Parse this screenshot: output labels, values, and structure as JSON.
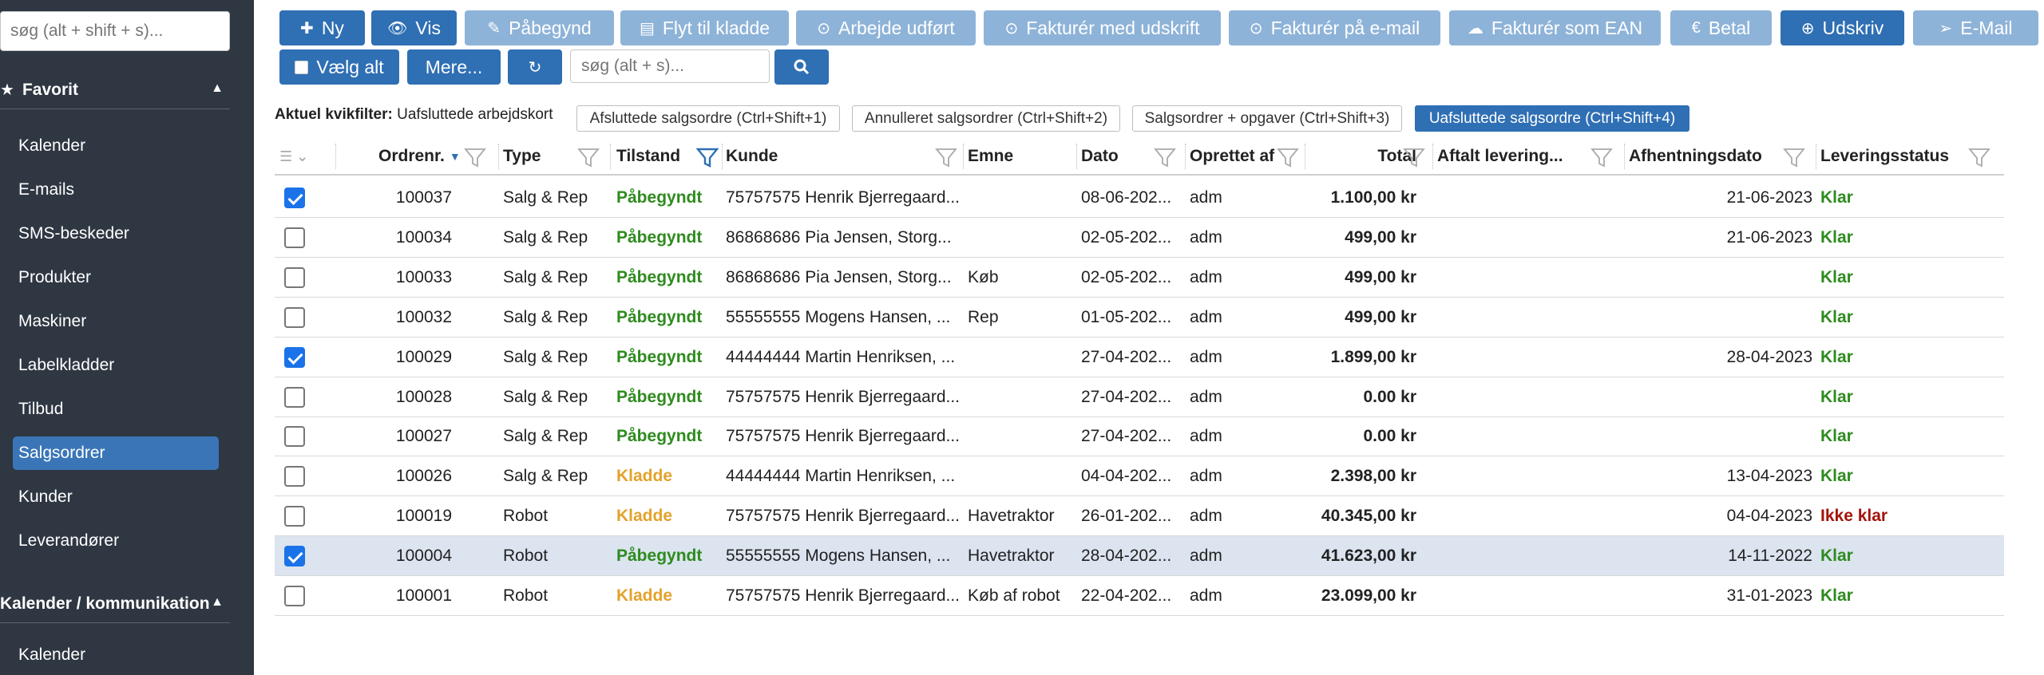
{
  "sidebar": {
    "search_placeholder": "søg (alt + shift + s)...",
    "favorites_title": "Favorit",
    "items": [
      "Kalender",
      "E-mails",
      "SMS-beskeder",
      "Produkter",
      "Maskiner",
      "Labelkladder",
      "Tilbud",
      "Salgsordrer",
      "Kunder",
      "Leverandører"
    ],
    "active_item": "Salgsordrer",
    "comm_title": "Kalender / kommunikation",
    "comm_items": [
      "Kalender"
    ]
  },
  "toolbar": {
    "ny": "Ny",
    "vis": "Vis",
    "paabegynd": "Påbegynd",
    "flyt": "Flyt til kladde",
    "arbejde": "Arbejde udført",
    "fak_udskrift": "Fakturér med udskrift",
    "fak_email": "Fakturér på e-mail",
    "fak_ean": "Fakturér som EAN",
    "betal": "Betal",
    "udskriv": "Udskriv",
    "email": "E-Mail",
    "vaelg_alt": "Vælg alt",
    "mere": "Mere...",
    "search_placeholder": "søg (alt + s)..."
  },
  "quickfilter": {
    "label": "Aktuel kvikfilter:",
    "current": "Uafsluttede arbejdskort",
    "buttons": [
      "Afsluttede salgsordre (Ctrl+Shift+1)",
      "Annulleret salgsordrer (Ctrl+Shift+2)",
      "Salgsordrer + opgaver (Ctrl+Shift+3)",
      "Uafsluttede salgsordre (Ctrl+Shift+4)"
    ],
    "active_index": 3
  },
  "table": {
    "columns": {
      "ordrenr": "Ordrenr.",
      "type": "Type",
      "tilstand": "Tilstand",
      "kunde": "Kunde",
      "emne": "Emne",
      "dato": "Dato",
      "oprettet": "Oprettet af",
      "total": "Total",
      "aftalt": "Aftalt levering...",
      "afhentning": "Afhentningsdato",
      "leveringsstatus": "Leveringsstatus"
    },
    "rows": [
      {
        "checked": true,
        "selected": false,
        "ordrenr": "100037",
        "type": "Salg & Rep",
        "tilstand": "Påbegyndt",
        "tilstand_kind": "green",
        "kunde": "75757575 Henrik Bjerregaard...",
        "emne": "",
        "dato": "08-06-202...",
        "oprettet": "adm",
        "total": "1.100,00 kr",
        "aftalt": "",
        "afhentning": "21-06-2023",
        "levering": "Klar",
        "levering_kind": "green"
      },
      {
        "checked": false,
        "selected": false,
        "ordrenr": "100034",
        "type": "Salg & Rep",
        "tilstand": "Påbegyndt",
        "tilstand_kind": "green",
        "kunde": "86868686 Pia Jensen, Storg...",
        "emne": "",
        "dato": "02-05-202...",
        "oprettet": "adm",
        "total": "499,00 kr",
        "aftalt": "",
        "afhentning": "21-06-2023",
        "levering": "Klar",
        "levering_kind": "green"
      },
      {
        "checked": false,
        "selected": false,
        "ordrenr": "100033",
        "type": "Salg & Rep",
        "tilstand": "Påbegyndt",
        "tilstand_kind": "green",
        "kunde": "86868686 Pia Jensen, Storg...",
        "emne": "Køb",
        "dato": "02-05-202...",
        "oprettet": "adm",
        "total": "499,00 kr",
        "aftalt": "",
        "afhentning": "",
        "levering": "Klar",
        "levering_kind": "green"
      },
      {
        "checked": false,
        "selected": false,
        "ordrenr": "100032",
        "type": "Salg & Rep",
        "tilstand": "Påbegyndt",
        "tilstand_kind": "green",
        "kunde": "55555555 Mogens Hansen, ...",
        "emne": "Rep",
        "dato": "01-05-202...",
        "oprettet": "adm",
        "total": "499,00 kr",
        "aftalt": "",
        "afhentning": "",
        "levering": "Klar",
        "levering_kind": "green"
      },
      {
        "checked": true,
        "selected": false,
        "ordrenr": "100029",
        "type": "Salg & Rep",
        "tilstand": "Påbegyndt",
        "tilstand_kind": "green",
        "kunde": "44444444 Martin Henriksen, ...",
        "emne": "",
        "dato": "27-04-202...",
        "oprettet": "adm",
        "total": "1.899,00 kr",
        "aftalt": "",
        "afhentning": "28-04-2023",
        "levering": "Klar",
        "levering_kind": "green"
      },
      {
        "checked": false,
        "selected": false,
        "ordrenr": "100028",
        "type": "Salg & Rep",
        "tilstand": "Påbegyndt",
        "tilstand_kind": "green",
        "kunde": "75757575 Henrik Bjerregaard...",
        "emne": "",
        "dato": "27-04-202...",
        "oprettet": "adm",
        "total": "0.00 kr",
        "aftalt": "",
        "afhentning": "",
        "levering": "Klar",
        "levering_kind": "green"
      },
      {
        "checked": false,
        "selected": false,
        "ordrenr": "100027",
        "type": "Salg & Rep",
        "tilstand": "Påbegyndt",
        "tilstand_kind": "green",
        "kunde": "75757575 Henrik Bjerregaard...",
        "emne": "",
        "dato": "27-04-202...",
        "oprettet": "adm",
        "total": "0.00 kr",
        "aftalt": "",
        "afhentning": "",
        "levering": "Klar",
        "levering_kind": "green"
      },
      {
        "checked": false,
        "selected": false,
        "ordrenr": "100026",
        "type": "Salg & Rep",
        "tilstand": "Kladde",
        "tilstand_kind": "orange",
        "kunde": "44444444 Martin Henriksen, ...",
        "emne": "",
        "dato": "04-04-202...",
        "oprettet": "adm",
        "total": "2.398,00 kr",
        "aftalt": "",
        "afhentning": "13-04-2023",
        "levering": "Klar",
        "levering_kind": "green"
      },
      {
        "checked": false,
        "selected": false,
        "ordrenr": "100019",
        "type": "Robot",
        "tilstand": "Kladde",
        "tilstand_kind": "orange",
        "kunde": "75757575 Henrik Bjerregaard...",
        "emne": "Havetraktor",
        "dato": "26-01-202...",
        "oprettet": "adm",
        "total": "40.345,00 kr",
        "aftalt": "",
        "afhentning": "04-04-2023",
        "levering": "Ikke klar",
        "levering_kind": "red"
      },
      {
        "checked": true,
        "selected": true,
        "ordrenr": "100004",
        "type": "Robot",
        "tilstand": "Påbegyndt",
        "tilstand_kind": "green",
        "kunde": "55555555 Mogens Hansen, ...",
        "emne": "Havetraktor",
        "dato": "28-04-202...",
        "oprettet": "adm",
        "total": "41.623,00 kr",
        "aftalt": "",
        "afhentning": "14-11-2022",
        "levering": "Klar",
        "levering_kind": "green"
      },
      {
        "checked": false,
        "selected": false,
        "ordrenr": "100001",
        "type": "Robot",
        "tilstand": "Kladde",
        "tilstand_kind": "orange",
        "kunde": "75757575 Henrik Bjerregaard...",
        "emne": "Køb af robot",
        "dato": "22-04-202...",
        "oprettet": "adm",
        "total": "23.099,00 kr",
        "aftalt": "",
        "afhentning": "31-01-2023",
        "levering": "Klar",
        "levering_kind": "green"
      }
    ]
  },
  "colors": {
    "sidebar_bg": "#2e3742",
    "primary": "#2f6fb4",
    "muted_button": "#8eb3d8",
    "status_green": "#2e8b1e",
    "status_orange": "#e3a22b",
    "status_red": "#a3130b",
    "selected_row": "#dbe4ef"
  },
  "icons": {
    "ny": "plus-icon",
    "vis": "eye-icon",
    "paabegynd": "edit-icon",
    "flyt": "file-icon",
    "arbejde": "check-circle-icon",
    "fak_udskrift": "check-circle-icon",
    "fak_email": "check-circle-icon",
    "fak_ean": "cloud-upload-icon",
    "betal": "euro-icon",
    "udskriv": "download-icon",
    "email": "paper-plane-icon",
    "refresh": "refresh-icon",
    "search": "search-icon",
    "filter": "funnel-icon"
  }
}
